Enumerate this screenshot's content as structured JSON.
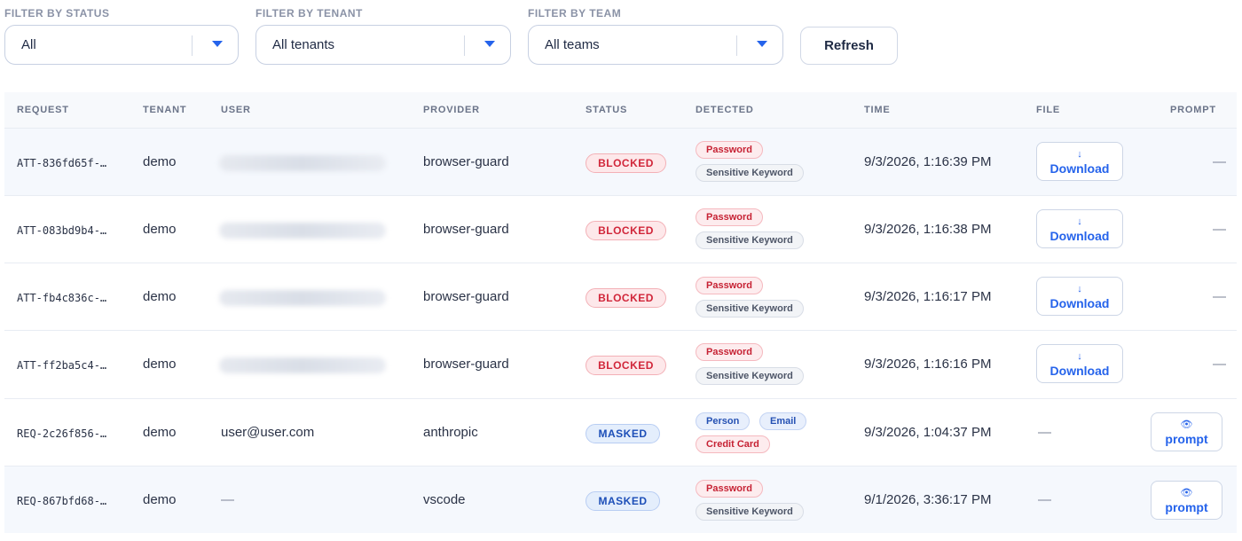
{
  "filters": {
    "status": {
      "label": "FILTER BY STATUS",
      "value": "All"
    },
    "tenant": {
      "label": "FILTER BY TENANT",
      "value": "All tenants"
    },
    "team": {
      "label": "FILTER BY TEAM",
      "value": "All teams"
    },
    "refresh_label": "Refresh"
  },
  "table": {
    "headers": {
      "request": "REQUEST",
      "tenant": "TENANT",
      "user": "USER",
      "provider": "PROVIDER",
      "status": "STATUS",
      "detected": "DETECTED",
      "time": "TIME",
      "file": "FILE",
      "prompt": "PROMPT"
    },
    "rows": [
      {
        "request": "ATT-836fd65f-…",
        "tenant": "demo",
        "user": "",
        "provider": "browser-guard",
        "status": "BLOCKED",
        "detected": [
          "Password",
          "Sensitive Keyword"
        ],
        "time": "9/3/2026, 1:16:39 PM",
        "file_icon": "↓",
        "file": "Download",
        "prompt": "—"
      },
      {
        "request": "ATT-083bd9b4-…",
        "tenant": "demo",
        "user": "",
        "provider": "browser-guard",
        "status": "BLOCKED",
        "detected": [
          "Password",
          "Sensitive Keyword"
        ],
        "time": "9/3/2026, 1:16:38 PM",
        "file_icon": "↓",
        "file": "Download",
        "prompt": "—"
      },
      {
        "request": "ATT-fb4c836c-…",
        "tenant": "demo",
        "user": "",
        "provider": "browser-guard",
        "status": "BLOCKED",
        "detected": [
          "Password",
          "Sensitive Keyword"
        ],
        "time": "9/3/2026, 1:16:17 PM",
        "file_icon": "↓",
        "file": "Download",
        "prompt": "—"
      },
      {
        "request": "ATT-ff2ba5c4-…",
        "tenant": "demo",
        "user": "",
        "provider": "browser-guard",
        "status": "BLOCKED",
        "detected": [
          "Password",
          "Sensitive Keyword"
        ],
        "time": "9/3/2026, 1:16:16 PM",
        "file_icon": "↓",
        "file": "Download",
        "prompt": "—"
      },
      {
        "request": "REQ-2c26f856-…",
        "tenant": "demo",
        "user": "user@user.com",
        "provider": "anthropic",
        "status": "MASKED",
        "detected": [
          "Person",
          "Email",
          "Credit Card"
        ],
        "time": "9/3/2026, 1:04:37 PM",
        "file": "—",
        "prompt_icon": "👁",
        "prompt": "prompt"
      },
      {
        "request": "REQ-867bfd68-…",
        "tenant": "demo",
        "user": "—",
        "provider": "vscode",
        "status": "MASKED",
        "detected": [
          "Password",
          "Sensitive Keyword"
        ],
        "time": "9/1/2026, 3:36:17 PM",
        "file": "—",
        "prompt_icon": "👁",
        "prompt": "prompt"
      }
    ]
  },
  "colors": {
    "accent": "#2563eb",
    "blocked": "#d1263a",
    "masked": "#1d4fb8"
  }
}
